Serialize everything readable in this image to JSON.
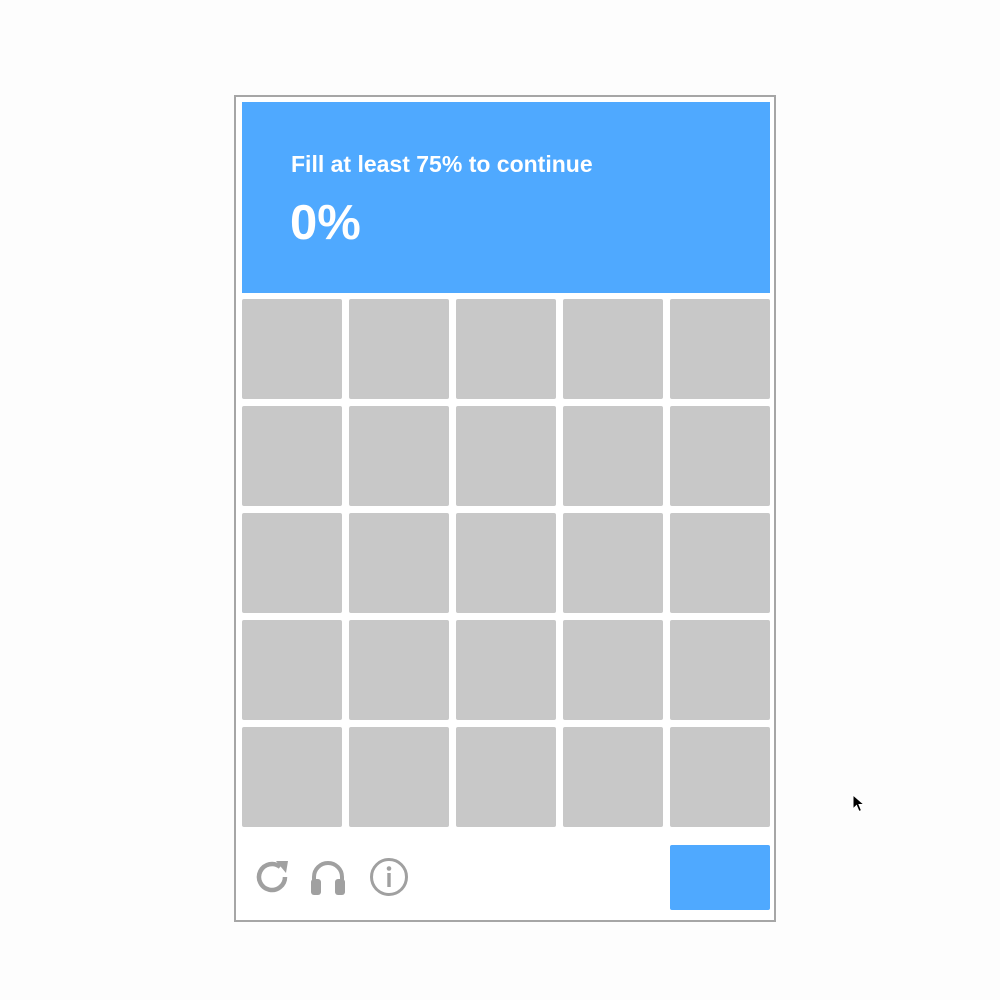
{
  "captcha": {
    "instruction": "Fill at least 75% to continue",
    "progress_text": "0%",
    "progress_value": 0,
    "required_value": 0.75,
    "grid": {
      "rows": 5,
      "columns": 5,
      "filled": [
        [
          false,
          false,
          false,
          false,
          false
        ],
        [
          false,
          false,
          false,
          false,
          false
        ],
        [
          false,
          false,
          false,
          false,
          false
        ],
        [
          false,
          false,
          false,
          false,
          false
        ],
        [
          false,
          false,
          false,
          false,
          false
        ]
      ]
    },
    "footer": {
      "icons": [
        "reload-icon",
        "headphones-icon",
        "info-icon"
      ],
      "submit_label": ""
    }
  },
  "colors": {
    "accent": "#4fa9ff",
    "cell_empty": "#c8c8c8",
    "icon_gray": "#a0a0a0",
    "frame_border": "#a6a6a6"
  }
}
